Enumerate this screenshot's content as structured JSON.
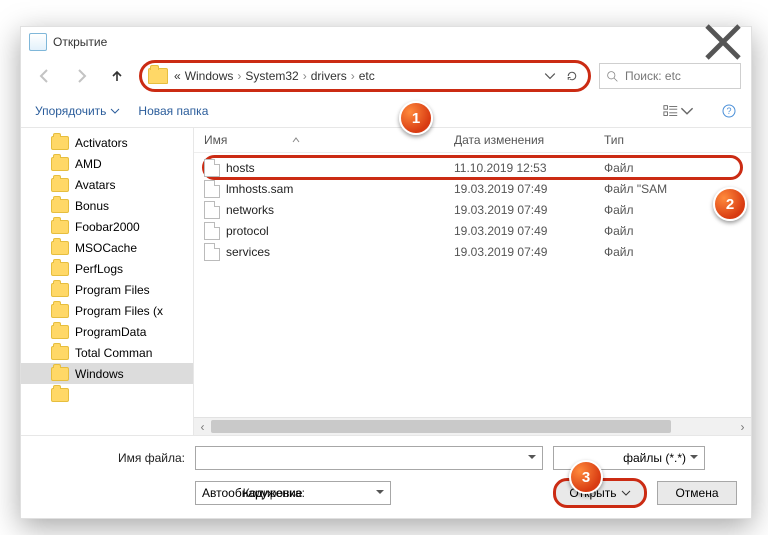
{
  "window": {
    "title": "Открытие"
  },
  "breadcrumb": {
    "prefix": "«",
    "parts": [
      "Windows",
      "System32",
      "drivers",
      "etc"
    ]
  },
  "search": {
    "placeholder": "Поиск: etc"
  },
  "toolbar": {
    "organize": "Упорядочить",
    "new_folder": "Новая папка"
  },
  "tree": {
    "items": [
      {
        "label": "Activators"
      },
      {
        "label": "AMD"
      },
      {
        "label": "Avatars"
      },
      {
        "label": "Bonus"
      },
      {
        "label": "Foobar2000"
      },
      {
        "label": "MSOCache"
      },
      {
        "label": "PerfLogs"
      },
      {
        "label": "Program Files"
      },
      {
        "label": "Program Files (x"
      },
      {
        "label": "ProgramData"
      },
      {
        "label": "Total Comman"
      },
      {
        "label": "Windows",
        "selected": true
      },
      {
        "label": ""
      }
    ]
  },
  "columns": {
    "name": "Имя",
    "date": "Дата изменения",
    "type": "Тип"
  },
  "files": [
    {
      "name": "hosts",
      "date": "11.10.2019 12:53",
      "type": "Файл",
      "highlight": true
    },
    {
      "name": "lmhosts.sam",
      "date": "19.03.2019 07:49",
      "type": "Файл \"SAM"
    },
    {
      "name": "networks",
      "date": "19.03.2019 07:49",
      "type": "Файл"
    },
    {
      "name": "protocol",
      "date": "19.03.2019 07:49",
      "type": "Файл"
    },
    {
      "name": "services",
      "date": "19.03.2019 07:49",
      "type": "Файл"
    }
  ],
  "footer": {
    "filename_label": "Имя файла:",
    "filename_value": "",
    "filter_label": "файлы (*.*)",
    "encoding_label": "Кодировка:",
    "encoding_value": "Автообнаружение",
    "open": "Открыть",
    "cancel": "Отмена"
  },
  "callouts": {
    "b1": "1",
    "b2": "2",
    "b3": "3"
  }
}
